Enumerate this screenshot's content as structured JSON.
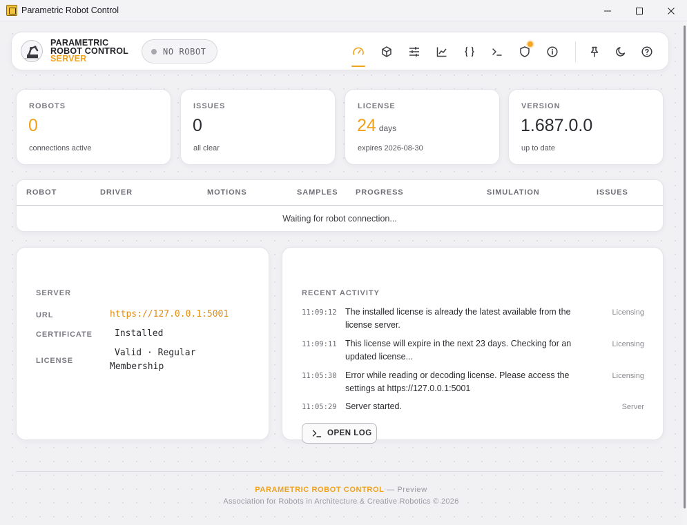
{
  "window": {
    "title": "Parametric Robot Control"
  },
  "header": {
    "brand_line1": "PARAMETRIC",
    "brand_line2": "ROBOT CONTROL",
    "brand_line3": "SERVER",
    "robot_status": "NO ROBOT",
    "nav_icons": [
      "dashboard-gauge-icon",
      "cube-icon",
      "sliders-icon",
      "chart-line-icon",
      "braces-icon",
      "terminal-icon",
      "shield-icon",
      "info-icon"
    ],
    "util_icons": [
      "pin-icon",
      "moon-icon",
      "help-icon"
    ],
    "accent_color": "#f0a21b"
  },
  "stats": {
    "robots": {
      "label": "ROBOTS",
      "value": "0",
      "sub": "connections active"
    },
    "issues": {
      "label": "ISSUES",
      "value": "0",
      "sub": "all clear"
    },
    "license": {
      "label": "LICENSE",
      "value": "24",
      "unit": "days",
      "sub": "expires 2026-08-30"
    },
    "version": {
      "label": "VERSION",
      "value": "1.687.0.0",
      "sub": "up to date"
    }
  },
  "robots_table": {
    "columns": [
      "ROBOT",
      "DRIVER",
      "MOTIONS",
      "SAMPLES",
      "PROGRESS",
      "SIMULATION",
      "ISSUES"
    ],
    "empty_message": "Waiting for robot connection..."
  },
  "server": {
    "title": "SERVER",
    "url_label": "URL",
    "url_value": "https://127.0.0.1:5001",
    "certificate_label": "CERTIFICATE",
    "certificate_value": "Installed",
    "license_label": "LICENSE",
    "license_value": "Valid · Regular Membership"
  },
  "activity": {
    "title": "RECENT ACTIVITY",
    "items": [
      {
        "time": "11:09:12",
        "message": "The installed license is already the latest available from the license server.",
        "source": "Licensing"
      },
      {
        "time": "11:09:11",
        "message": "This license will expire in the next 23 days. Checking for an updated license...",
        "source": "Licensing"
      },
      {
        "time": "11:05:30",
        "message": "Error while reading or decoding license. Please access the settings at https://127.0.0.1:5001",
        "source": "Licensing"
      },
      {
        "time": "11:05:29",
        "message": "Server started.",
        "source": "Server"
      }
    ],
    "open_log_label": "OPEN LOG"
  },
  "footer": {
    "brand": "PARAMETRIC ROBOT CONTROL",
    "separator": " — ",
    "mode": "Preview",
    "credit": "Association for Robots in Architecture & Creative Robotics © 2026"
  }
}
